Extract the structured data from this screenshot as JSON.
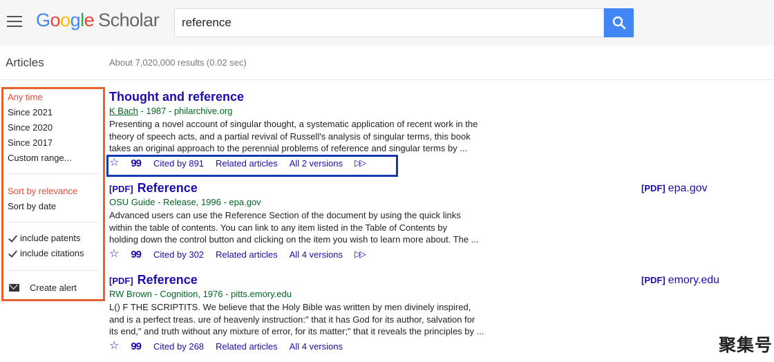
{
  "header": {
    "logo_google": [
      "G",
      "o",
      "o",
      "g",
      "l",
      "e"
    ],
    "logo_scholar": "Scholar",
    "search_value": "reference"
  },
  "subbar": {
    "articles": "Articles",
    "results_count": "About 7,020,000 results (0.02 sec)"
  },
  "sidebar": {
    "time_filters": [
      "Any time",
      "Since 2021",
      "Since 2020",
      "Since 2017",
      "Custom range..."
    ],
    "sort_options": [
      "Sort by relevance",
      "Sort by date"
    ],
    "checks": [
      "include patents",
      "include citations"
    ],
    "create_alert": "Create alert",
    "accent_color": "#e8602c"
  },
  "results": [
    {
      "pdf_tag": "",
      "title_pre": "Thought and ",
      "title_bold": "reference",
      "author": "K Bach",
      "meta_rest": " - 1987 - philarchive.org",
      "snippet": [
        "Presenting a novel account of singular thought, a systematic application of recent work in the",
        "theory of speech acts, and a partial revival of Russell's analysis of singular terms, this book",
        "takes an original approach to the perennial problems of reference and singular terms by ..."
      ],
      "cited_by": "Cited by 891",
      "related": "Related articles",
      "versions": "All 2 versions",
      "side_link": ""
    },
    {
      "pdf_tag": "[PDF]",
      "title_pre": "",
      "title_bold": "Reference",
      "author": "",
      "meta_rest": "OSU Guide - Release, 1996 - epa.gov",
      "snippet": [
        "Advanced users can use the Reference Section of the document by using the quick links",
        "within the table of contents. You can link to any item listed in the Table of Contents by",
        "holding down the control button and clicking on the item you wish to learn more about. The ..."
      ],
      "cited_by": "Cited by 302",
      "related": "Related articles",
      "versions": "All 4 versions",
      "side_link_tag": "[PDF]",
      "side_link": "epa.gov"
    },
    {
      "pdf_tag": "[PDF]",
      "title_pre": "",
      "title_bold": "Reference",
      "author": "",
      "meta_rest": "RW Brown - Cognition, 1976 - pitts.emory.edu",
      "snippet": [
        "L() F THE SCRIPTITS. We believe that the Holy Bible was written by men divinely inspired,",
        "and is a perfect treas. ure of heavenly instruction:\" that it has God for its author, salvation for",
        "its end,\" and truth without any mixture of error, for its matter;\" that it reveals the principles by ..."
      ],
      "cited_by": "Cited by 268",
      "related": "Related articles",
      "versions": "All 4 versions",
      "side_link_tag": "[PDF]",
      "side_link": "emory.edu"
    }
  ],
  "icons": {
    "menu": "hamburger-menu-icon",
    "search": "search-icon",
    "star": "star-icon",
    "quote": "quote-icon",
    "more": "more-icon",
    "alert": "envelope-icon"
  },
  "colors": {
    "link": "#1a0dab",
    "green": "#006621",
    "search_button": "#4285f4",
    "action_box": "#1538b4"
  },
  "watermark": "聚集号"
}
